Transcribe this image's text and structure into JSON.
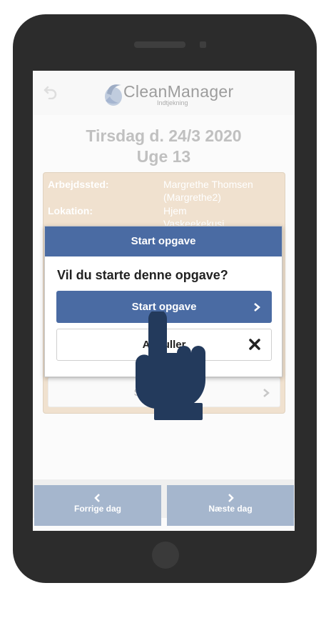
{
  "app": {
    "name": "CleanManager",
    "subtitle": "Indtjekning"
  },
  "day": {
    "date_title": "Tirsdag d. 24/3 2020",
    "week_title": "Uge 13"
  },
  "task_card": {
    "workplace_label": "Arbejdssted:",
    "workplace_value_line1": "Margrethe Thomsen",
    "workplace_value_line2": "(Margrethe2)",
    "location_label": "Lokation:",
    "location_value": "Hjem",
    "location_value_partial": "Vaskeekekusi",
    "start_button_label": "Start opgave"
  },
  "modal": {
    "title": "Start opgave",
    "question": "Vil du starte denne opgave?",
    "confirm_label": "Start opgave",
    "cancel_label": "Annuller"
  },
  "bottom_nav": {
    "prev_label": "Forrige dag",
    "next_label": "Næste dag"
  },
  "colors": {
    "primary_blue": "#4a6ba3",
    "card_tan": "#e3c9a8",
    "nav_button": "#a5b6cd",
    "hand": "#233a5c"
  }
}
